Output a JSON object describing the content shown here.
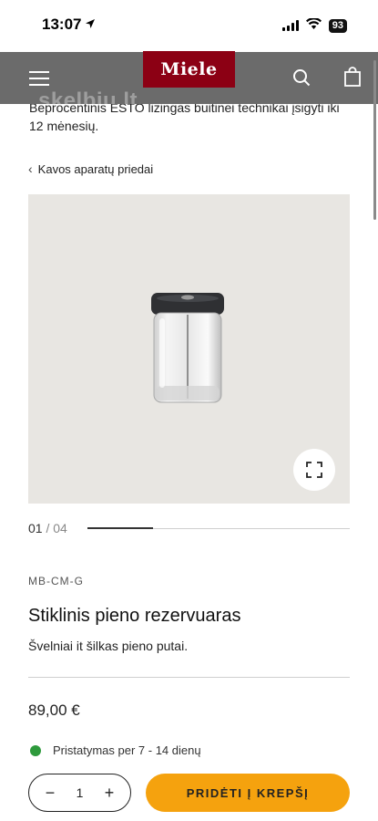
{
  "status_bar": {
    "time": "13:07",
    "battery": "93"
  },
  "header": {
    "logo": "Miele",
    "watermark": "skelbiu.lt"
  },
  "promo": {
    "text": "Beprocentinis ESTO lizingas buitinei technikai įsigyti iki 12 mėnesių."
  },
  "breadcrumb": {
    "label": "Kavos aparatų priedai"
  },
  "gallery": {
    "current": "01",
    "separator": "/",
    "total": "04",
    "progress": 0.25
  },
  "product": {
    "sku": "MB-CM-G",
    "title": "Stiklinis pieno rezervuaras",
    "subtitle": "Švelniai it šilkas pieno putai.",
    "price": "89,00 €",
    "delivery": "Pristatymas per 7 - 14 dienų"
  },
  "cart": {
    "quantity": "1",
    "minus": "−",
    "plus": "+",
    "add_label": "PRIDĖTI Į KREPŠĮ"
  },
  "colors": {
    "brand": "#8c0014",
    "cta": "#f5a20e",
    "in_stock": "#2e9a3c"
  }
}
